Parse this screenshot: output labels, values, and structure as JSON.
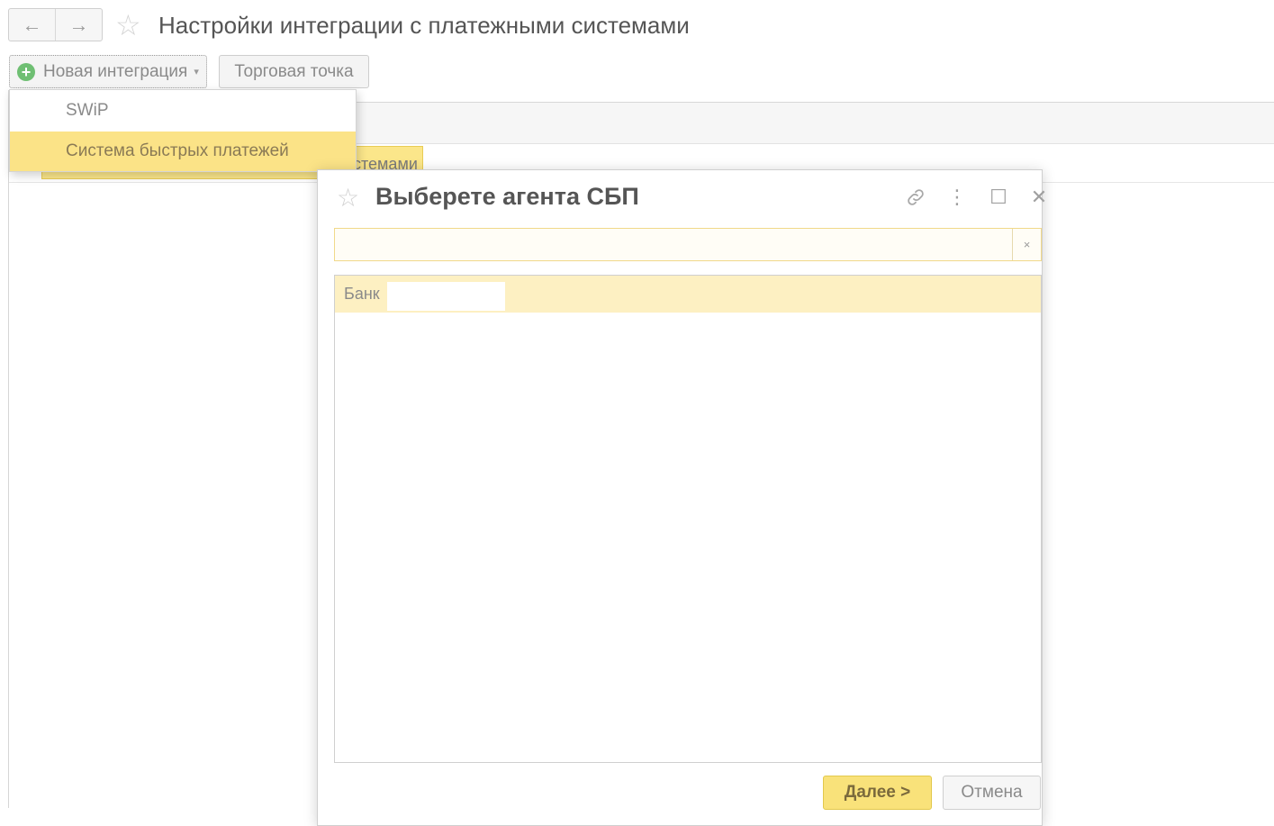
{
  "header": {
    "title": "Настройки интеграции с платежными системами",
    "back_icon": "←",
    "forward_icon": "→",
    "favorite_icon": "☆"
  },
  "toolbar": {
    "new_integration_label": "Новая интеграция",
    "plus_icon": "+",
    "caret_icon": "▾",
    "trade_point_label": "Торговая точка"
  },
  "dropdown": {
    "items": [
      {
        "label": "SWiP"
      },
      {
        "label": "Система быстрых платежей"
      }
    ]
  },
  "background_list": {
    "row_fragment": "стемами"
  },
  "dialog": {
    "title": "Выберете агента СБП",
    "favorite_icon": "☆",
    "link_icon": "🔗",
    "more_icon": "⋮",
    "maximize_icon": "☐",
    "close_icon": "✕",
    "search_value": "",
    "search_clear_icon": "×",
    "list_rows": [
      {
        "label": "Банк",
        "value": ""
      }
    ],
    "next_label": "Далее >",
    "cancel_label": "Отмена"
  },
  "colors": {
    "accent_yellow": "#fbe387",
    "highlight_row": "#fdf0c2",
    "plus_green": "#6fbf73"
  }
}
